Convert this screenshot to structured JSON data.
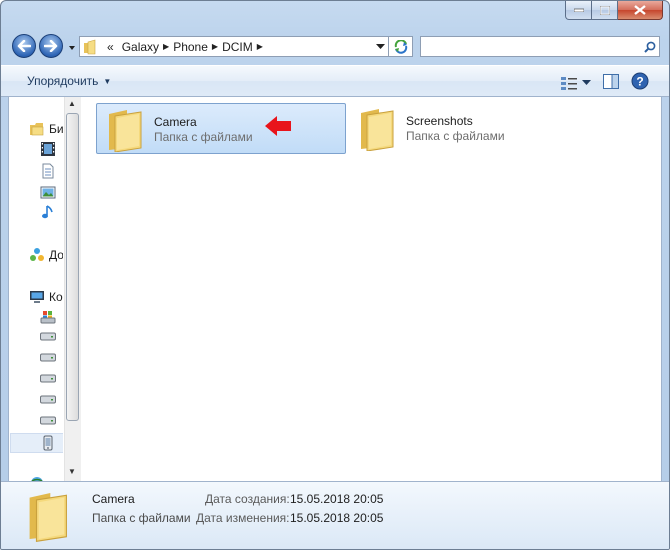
{
  "address": {
    "overflow": "«",
    "crumbs": [
      "Galaxy",
      "Phone",
      "DCIM"
    ]
  },
  "search": {
    "placeholder": "",
    "value": ""
  },
  "toolbar": {
    "organize_label": "Упорядочить"
  },
  "navpane": {
    "items": [
      {
        "label": "Би",
        "icon": "libraries-icon"
      },
      {
        "label": "",
        "icon": "videos-icon"
      },
      {
        "label": "",
        "icon": "documents-icon"
      },
      {
        "label": "",
        "icon": "pictures-icon"
      },
      {
        "label": "",
        "icon": "music-icon"
      },
      {
        "label": "До",
        "icon": "homegroup-icon"
      },
      {
        "label": "Ко",
        "icon": "computer-icon"
      },
      {
        "label": "",
        "icon": "system-drive-icon"
      },
      {
        "label": "",
        "icon": "drive-icon"
      },
      {
        "label": "",
        "icon": "drive-icon"
      },
      {
        "label": "",
        "icon": "drive-icon"
      },
      {
        "label": "",
        "icon": "drive-icon"
      },
      {
        "label": "",
        "icon": "drive-icon"
      },
      {
        "label": "",
        "icon": "phone-device-icon"
      },
      {
        "label": "",
        "icon": "network-icon"
      }
    ]
  },
  "files": [
    {
      "name": "Camera",
      "type": "Папка с файлами",
      "selected": true
    },
    {
      "name": "Screenshots",
      "type": "Папка с файлами",
      "selected": false
    }
  ],
  "details": {
    "name": "Camera",
    "type": "Папка с файлами",
    "created_label": "Дата создания:",
    "created_value": "15.05.2018 20:05",
    "modified_label": "Дата изменения:",
    "modified_value": "15.05.2018 20:05"
  },
  "colors": {
    "accent_arrow": "#e8141b",
    "folder": "#f2d16b",
    "selection": "#cde3fb"
  }
}
